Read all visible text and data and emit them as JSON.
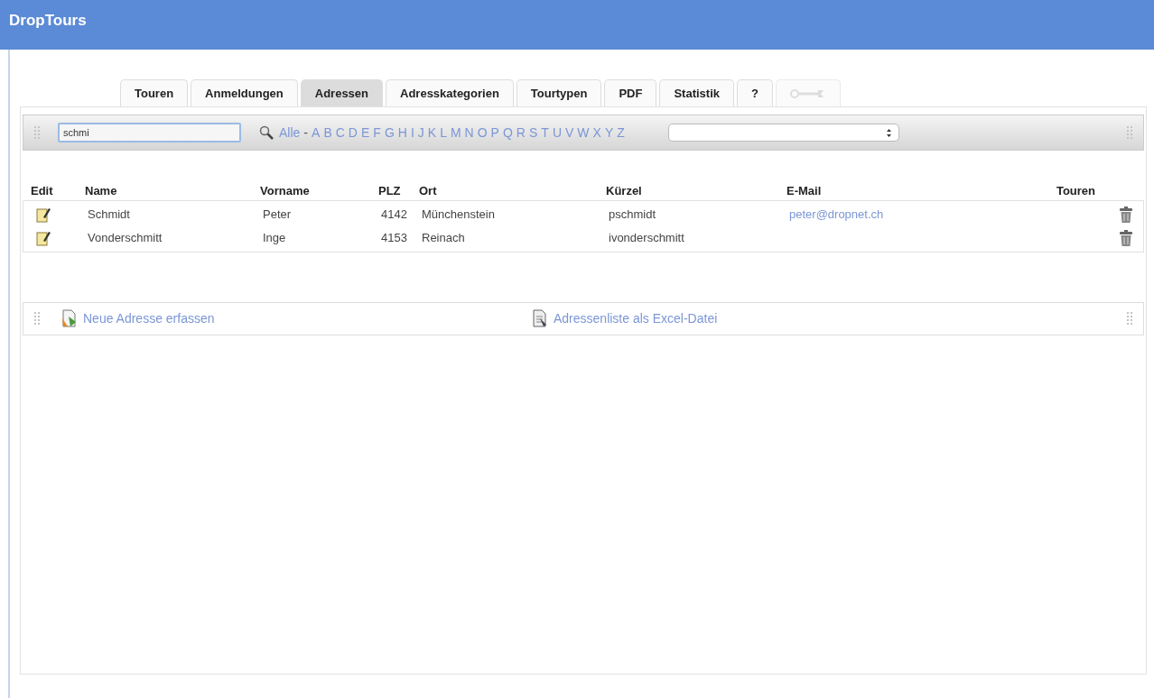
{
  "window": {
    "title": "DropTours"
  },
  "tabs": [
    {
      "kind": "text",
      "label": "Touren",
      "selected": false,
      "disabled": false
    },
    {
      "kind": "text",
      "label": "Anmeldungen",
      "selected": false,
      "disabled": false
    },
    {
      "kind": "text",
      "label": "Adressen",
      "selected": true,
      "disabled": false
    },
    {
      "kind": "text",
      "label": "Adresskategorien",
      "selected": false,
      "disabled": false
    },
    {
      "kind": "text",
      "label": "Tourtypen",
      "selected": false,
      "disabled": false
    },
    {
      "kind": "text",
      "label": "PDF",
      "selected": false,
      "disabled": false
    },
    {
      "kind": "text",
      "label": "Statistik",
      "selected": false,
      "disabled": false
    },
    {
      "kind": "text",
      "label": "?",
      "selected": false,
      "disabled": false
    },
    {
      "kind": "icon",
      "selected": false,
      "disabled": true
    }
  ],
  "search": {
    "value": "schmi"
  },
  "letter_filter": {
    "all": "Alle",
    "separator": "-",
    "letters": [
      "A",
      "B",
      "C",
      "D",
      "E",
      "F",
      "G",
      "H",
      "I",
      "J",
      "K",
      "L",
      "M",
      "N",
      "O",
      "P",
      "Q",
      "R",
      "S",
      "T",
      "U",
      "V",
      "W",
      "X",
      "Y",
      "Z"
    ]
  },
  "table": {
    "columns": [
      "Edit",
      "Name",
      "Vorname",
      "PLZ",
      "Ort",
      "Kürzel",
      "E-Mail",
      "Touren"
    ],
    "rows": [
      {
        "name": "Schmidt",
        "vorname": "Peter",
        "plz": "4142",
        "ort": "Münchenstein",
        "kuerzel": "pschmidt",
        "email": "peter@dropnet.ch"
      },
      {
        "name": "Vonderschmitt",
        "vorname": "Inge",
        "plz": "4153",
        "ort": "Reinach",
        "kuerzel": "ivonderschmitt"
      }
    ]
  },
  "actions": [
    {
      "kind": "new",
      "label": "Neue Adresse erfassen"
    },
    {
      "kind": "excel",
      "label": "Adressenliste als Excel-Datei"
    }
  ]
}
